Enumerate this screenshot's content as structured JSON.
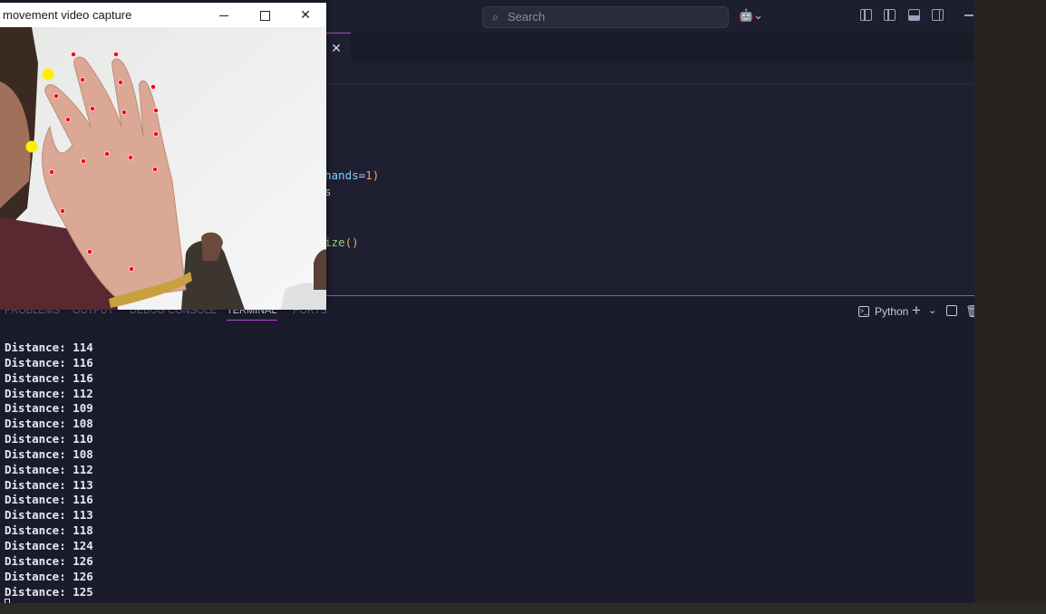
{
  "vscode": {
    "search_placeholder": "Search",
    "editor_tab_close": "✕",
    "code_lines": [
      {
        "segments": [
          {
            "t": "hands",
            "c": "var"
          },
          {
            "t": "=",
            "c": "punc"
          },
          {
            "t": "1",
            "c": "num"
          },
          {
            "t": ")",
            "c": "paren"
          }
        ]
      },
      {
        "segments": [
          {
            "t": "s",
            "c": "plain"
          }
        ]
      },
      {
        "segments": [
          {
            "t": "ize",
            "c": "fn"
          },
          {
            "t": "()",
            "c": "paren"
          }
        ]
      }
    ],
    "panel_tabs": [
      "PROBLEMS",
      "OUTPUT",
      "DEBUG CONSOLE",
      "TERMINAL",
      "PORTS"
    ],
    "active_panel_tab": "TERMINAL",
    "terminal_profile": "Python",
    "terminal_lines": [
      "Distance: 114",
      "Distance: 116",
      "Distance: 116",
      "Distance: 112",
      "Distance: 109",
      "Distance: 108",
      "Distance: 110",
      "Distance: 108",
      "Distance: 112",
      "Distance: 113",
      "Distance: 116",
      "Distance: 113",
      "Distance: 118",
      "Distance: 124",
      "Distance: 126",
      "Distance: 126",
      "Distance: 125"
    ]
  },
  "capture_window": {
    "title": "movement video capture",
    "close_glyph": "✕"
  },
  "colors": {
    "accent": "#b04ad0",
    "landmark_dot": "#ff0000",
    "fingertip_marker": "#ffee00"
  }
}
